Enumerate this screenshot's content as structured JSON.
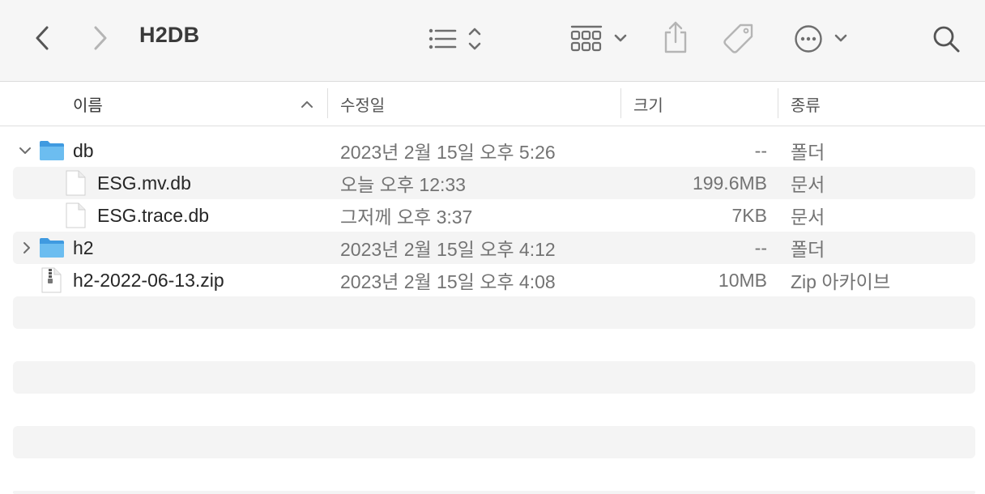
{
  "window": {
    "title": "H2DB"
  },
  "toolbar": {
    "back": "chevron-left-icon",
    "forward": "chevron-right-icon",
    "list_view": "list-view-icon",
    "group": "grid-group-icon",
    "share": "share-icon",
    "tag": "tag-icon",
    "more": "ellipsis-circle-icon",
    "search": "search-icon"
  },
  "columns": {
    "name": "이름",
    "modified": "수정일",
    "size": "크기",
    "kind": "종류"
  },
  "files": [
    {
      "name": "db",
      "modified": "2023년 2월 15일 오후 5:26",
      "size": "--",
      "kind": "폴더",
      "type": "folder",
      "expanded": true
    },
    {
      "name": "ESG.mv.db",
      "modified": "오늘 오후 12:33",
      "size": "199.6MB",
      "kind": "문서",
      "type": "document",
      "child": true
    },
    {
      "name": "ESG.trace.db",
      "modified": "그저께 오후 3:37",
      "size": "7KB",
      "kind": "문서",
      "type": "document",
      "child": true
    },
    {
      "name": "h2",
      "modified": "2023년 2월 15일 오후 4:12",
      "size": "--",
      "kind": "폴더",
      "type": "folder",
      "expanded": false
    },
    {
      "name": "h2-2022-06-13.zip",
      "modified": "2023년 2월 15일 오후 4:08",
      "size": "10MB",
      "kind": "Zip 아카이브",
      "type": "zip"
    }
  ],
  "colors": {
    "folder": "#5aaee8",
    "stripe": "#f4f4f4",
    "icon": "#6e6e6e"
  }
}
